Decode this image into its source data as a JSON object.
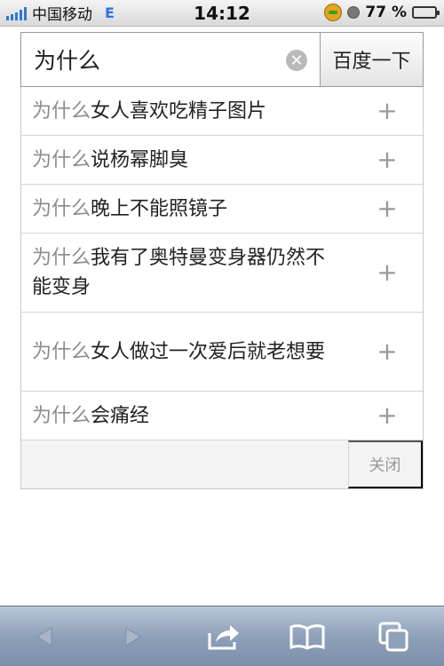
{
  "status_bar": {
    "carrier": "中国移动",
    "network": "E",
    "time": "14:12",
    "battery_percent": "77 %",
    "battery_level": 0.77
  },
  "search": {
    "query": "为什么",
    "button_label": "百度一下"
  },
  "suggestions": {
    "prefix": "为什么",
    "items": [
      {
        "rest": "女人喜欢吃精子图片"
      },
      {
        "rest": "说杨幂脚臭"
      },
      {
        "rest": "晚上不能照镜子"
      },
      {
        "rest": "我有了奥特曼变身器仍然不能变身"
      },
      {
        "rest": "女人做过一次爱后就老想要"
      },
      {
        "rest": "会痛经"
      }
    ],
    "close_label": "关闭"
  },
  "icons": {
    "clear": "clear-icon",
    "add": "plus-icon",
    "back": "back-arrow-icon",
    "forward": "forward-arrow-icon",
    "share": "share-icon",
    "bookmarks": "bookmarks-icon",
    "tabs": "tabs-icon"
  },
  "colors": {
    "toolbar": "#8fa1b9",
    "signal": "#2d76d8",
    "prefix_text": "#8c8c8c"
  }
}
